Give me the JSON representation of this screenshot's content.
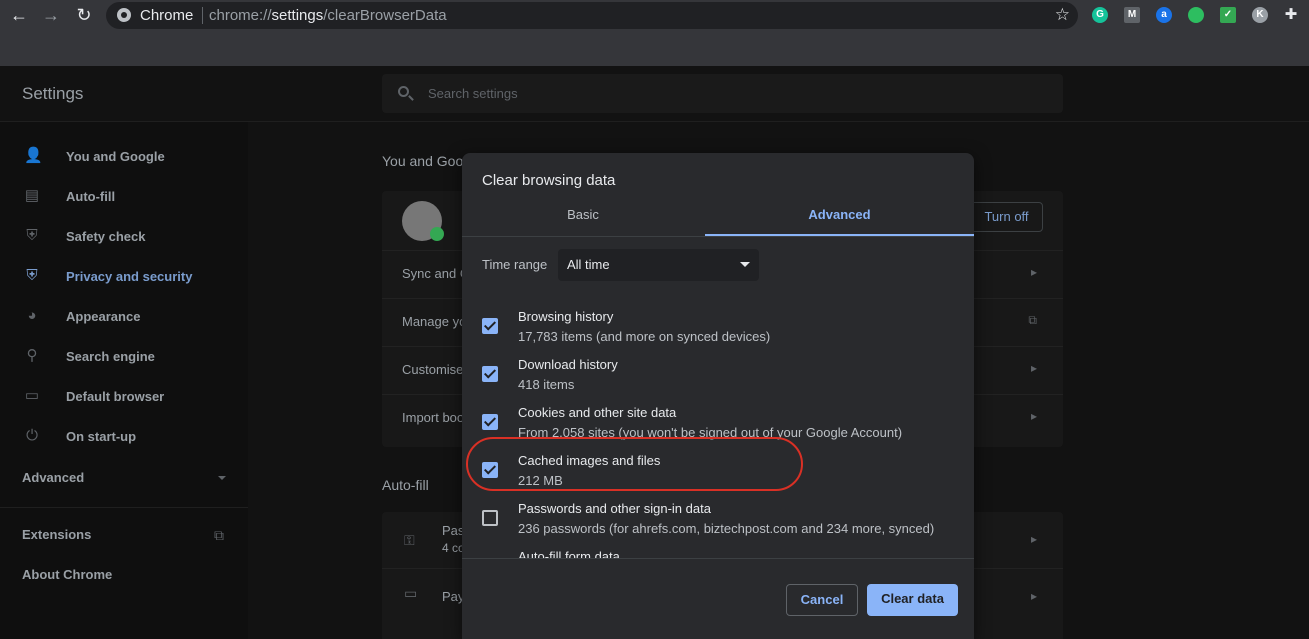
{
  "browser": {
    "site_label": "Chrome",
    "url_scheme": "chrome://",
    "url_host": "settings",
    "url_path": "/clearBrowserData",
    "extensions": [
      {
        "name": "grammarly-icon",
        "letter": "G",
        "color": "#15c39a"
      },
      {
        "name": "gmail-tool-icon",
        "letter": "M",
        "color": "#5f6368"
      },
      {
        "name": "ahrefs-icon",
        "letter": "a",
        "color": "#1a73e8"
      },
      {
        "name": "evernote-icon",
        "letter": "",
        "color": "#2dbe60"
      },
      {
        "name": "mail-check-icon",
        "letter": "✓",
        "color": "#34a853"
      },
      {
        "name": "profile-icon",
        "letter": "K",
        "color": "#9aa0a6"
      }
    ]
  },
  "settings": {
    "title": "Settings",
    "search_placeholder": "Search settings",
    "sidebar": [
      {
        "label": "You and Google",
        "icon": "person-icon",
        "glyph": "👤",
        "active": false
      },
      {
        "label": "Auto-fill",
        "icon": "clipboard-icon",
        "glyph": "▤",
        "active": false
      },
      {
        "label": "Safety check",
        "icon": "shield-icon",
        "glyph": "⛨",
        "active": false
      },
      {
        "label": "Privacy and security",
        "icon": "shield-half-icon",
        "glyph": "⛨",
        "active": true
      },
      {
        "label": "Appearance",
        "icon": "palette-icon",
        "glyph": "◕",
        "active": false
      },
      {
        "label": "Search engine",
        "icon": "search-icon",
        "glyph": "⚲",
        "active": false
      },
      {
        "label": "Default browser",
        "icon": "browser-icon",
        "glyph": "▭",
        "active": false
      },
      {
        "label": "On start-up",
        "icon": "power-icon",
        "glyph": "⏻",
        "active": false
      }
    ],
    "advanced_label": "Advanced",
    "extensions_label": "Extensions",
    "about_label": "About Chrome",
    "section_you": "You and Goo",
    "turn_off_label": "Turn off",
    "rows": [
      "Sync and G",
      "Manage yo",
      "Customise",
      "Import boo"
    ],
    "section_autofill": "Auto-fill",
    "autofill_rows": [
      {
        "label": "Pas",
        "sub": "4 co"
      },
      {
        "label": "Pay",
        "sub": ""
      }
    ]
  },
  "dialog": {
    "title": "Clear browsing data",
    "tabs": {
      "basic": "Basic",
      "advanced": "Advanced"
    },
    "time_range_label": "Time range",
    "time_range_value": "All time",
    "options": [
      {
        "title": "Browsing history",
        "sub": "17,783 items (and more on synced devices)",
        "checked": true
      },
      {
        "title": "Download history",
        "sub": "418 items",
        "checked": true
      },
      {
        "title": "Cookies and other site data",
        "sub": "From 2,058 sites (you won't be signed out of your Google Account)",
        "checked": true
      },
      {
        "title": "Cached images and files",
        "sub": "212 MB",
        "checked": true
      },
      {
        "title": "Passwords and other sign-in data",
        "sub": "236 passwords (for ahrefs.com, biztechpost.com and 234 more, synced)",
        "checked": false
      },
      {
        "title": "Auto-fill form data",
        "sub": "",
        "checked": true
      }
    ],
    "cancel_label": "Cancel",
    "clear_label": "Clear data"
  }
}
